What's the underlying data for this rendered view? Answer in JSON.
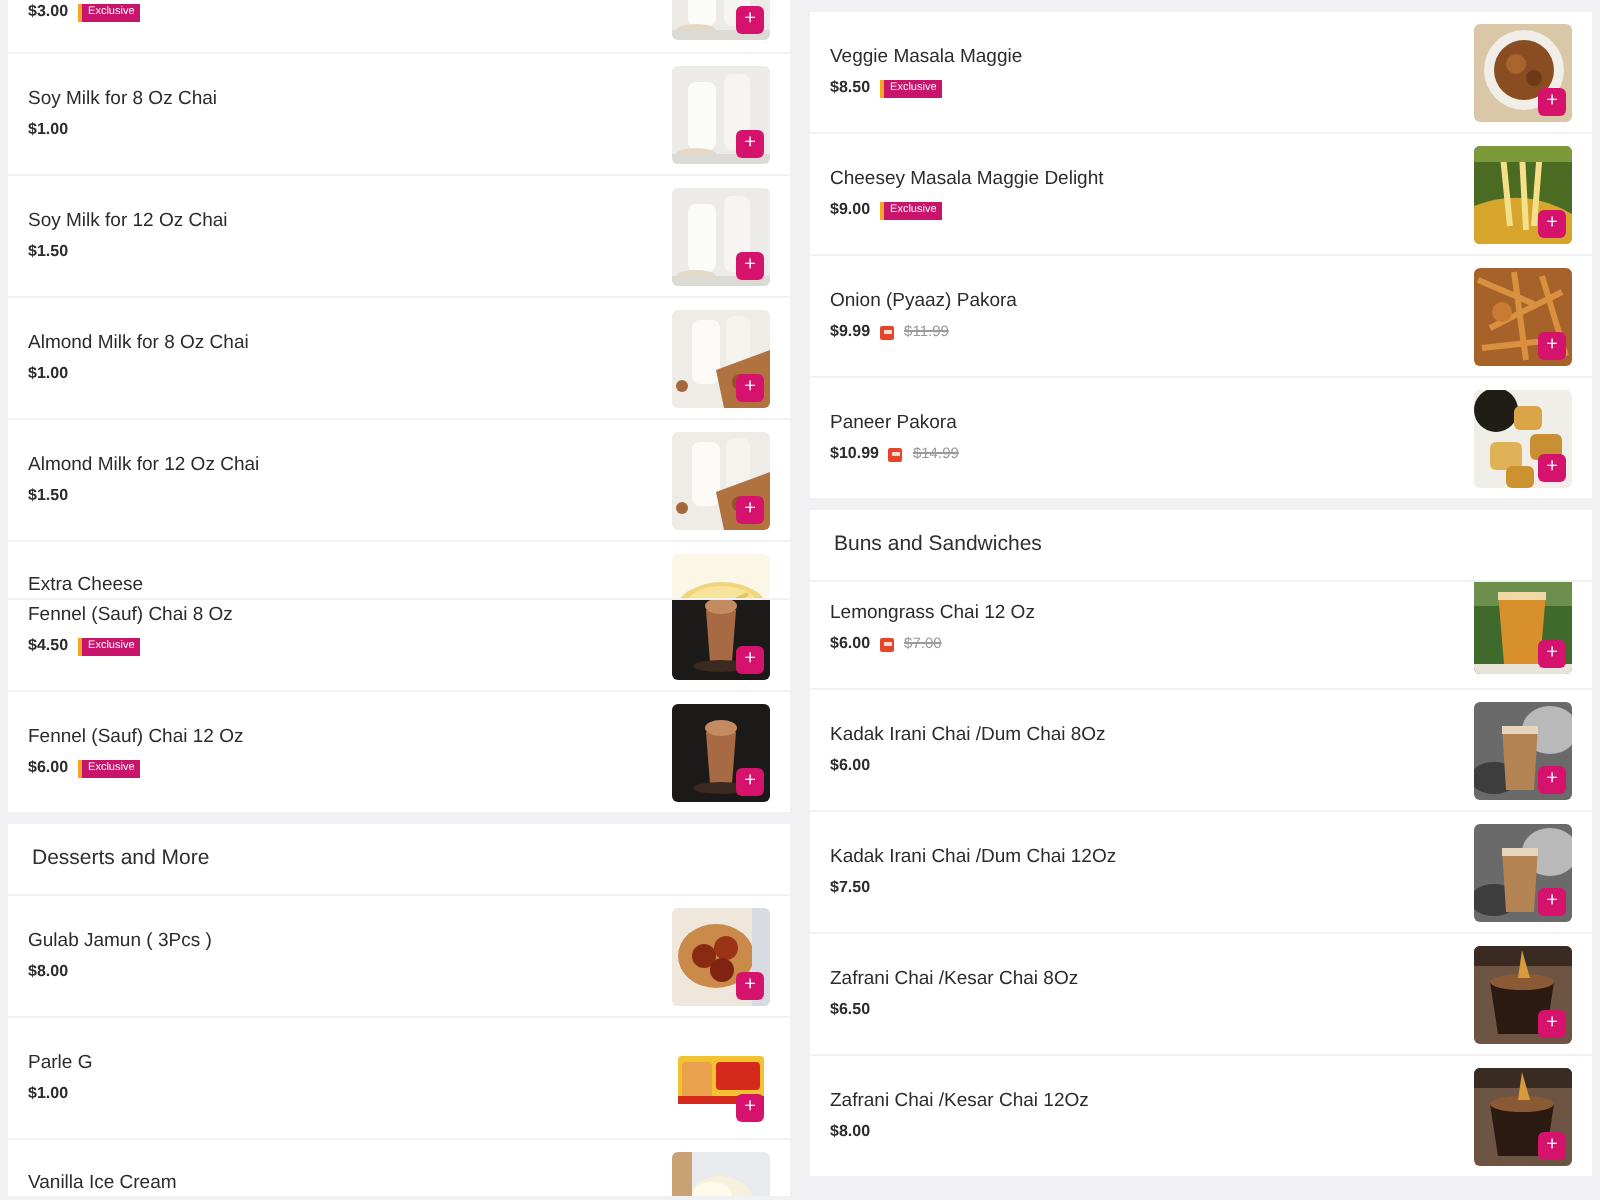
{
  "columns": [
    {
      "sections": [
        {
          "rows": [
            {
              "kind": "edge",
              "price": "$3.00",
              "badge": "Exclusive",
              "add": "+"
            },
            {
              "kind": "item",
              "name": "Soy Milk for 8 Oz Chai",
              "price": "$1.00",
              "add": "+"
            },
            {
              "kind": "item",
              "name": "Soy Milk for 12 Oz Chai",
              "price": "$1.50",
              "add": "+"
            },
            {
              "kind": "item",
              "name": "Almond Milk for 8 Oz Chai",
              "price": "$1.00",
              "add": "+"
            },
            {
              "kind": "item",
              "name": "Almond Milk for 12 Oz Chai",
              "price": "$1.50",
              "add": "+"
            },
            {
              "kind": "cut_bottom",
              "name": "Extra Cheese"
            },
            {
              "kind": "cut_top",
              "name": "Fennel (Sauf) Chai 8 Oz",
              "price": "$4.50",
              "badge": "Exclusive",
              "add": "+"
            },
            {
              "kind": "item",
              "name": "Fennel (Sauf) Chai 12 Oz",
              "price": "$6.00",
              "badge": "Exclusive",
              "add": "+"
            }
          ]
        },
        {
          "title": "Desserts and More",
          "rows": [
            {
              "kind": "item",
              "name": "Gulab Jamun ( 3Pcs )",
              "price": "$8.00",
              "add": "+"
            },
            {
              "kind": "item",
              "name": "Parle G",
              "price": "$1.00",
              "add": "+"
            },
            {
              "kind": "cut_bottom",
              "name": "Vanilla Ice Cream"
            }
          ]
        }
      ]
    },
    {
      "sections": [
        {
          "rows": [
            {
              "kind": "item",
              "name": "Veggie Masala Maggie",
              "price": "$8.50",
              "badge": "Exclusive",
              "add": "+"
            },
            {
              "kind": "item",
              "name": "Cheesey Masala Maggie Delight",
              "price": "$9.00",
              "badge": "Exclusive",
              "add": "+"
            },
            {
              "kind": "item",
              "name": "Onion (Pyaaz) Pakora",
              "price": "$9.99",
              "old_price": "$11.99",
              "add": "+"
            },
            {
              "kind": "item",
              "name": "Paneer Pakora",
              "price": "$10.99",
              "old_price": "$14.99",
              "add": "+"
            }
          ]
        },
        {
          "title": "Buns and Sandwiches",
          "rows": [
            {
              "kind": "seam",
              "name": "Lemongrass Chai 12 Oz",
              "price": "$6.00",
              "old_price": "$7.00",
              "add": "+"
            },
            {
              "kind": "item",
              "name": "Kadak Irani Chai /Dum Chai 8Oz",
              "price": "$6.00",
              "add": "+"
            },
            {
              "kind": "item",
              "name": "Kadak Irani Chai /Dum Chai 12Oz",
              "price": "$7.50",
              "add": "+"
            },
            {
              "kind": "item",
              "name": "Zafrani Chai /Kesar Chai 8Oz",
              "price": "$6.50",
              "add": "+"
            },
            {
              "kind": "item",
              "name": "Zafrani Chai /Kesar Chai 12Oz",
              "price": "$8.00",
              "add": "+"
            }
          ]
        }
      ]
    }
  ]
}
